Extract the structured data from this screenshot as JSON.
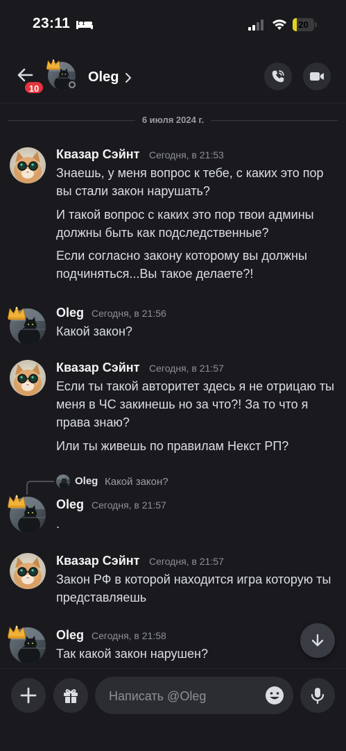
{
  "status_bar": {
    "time": "23:11",
    "battery_level": "20",
    "battery_fraction": 0.2,
    "battery_color": "#e4d11f"
  },
  "header": {
    "back_badge": "10",
    "contact_name": "Oleg",
    "icons": [
      "back-arrow-icon",
      "chevron-right-icon",
      "phone-call-icon",
      "video-camera-icon"
    ]
  },
  "date_divider": "6 июля 2024 г.",
  "messages": [
    {
      "author": "Квазар Сэйнт",
      "time": "Сегодня, в 21:53",
      "lines": [
        "Знаешь, у меня вопрос к тебе, с каких это пор вы стали закон нарушать?",
        "И такой вопрос с каких это пор твои админы должны быть как подследственные?",
        "Если согласно закону которому вы должны подчиняться...Вы такое делаете?!"
      ]
    },
    {
      "author": "Oleg",
      "time": "Сегодня, в 21:56",
      "lines": [
        "Какой закон?"
      ]
    },
    {
      "author": "Квазар Сэйнт",
      "time": "Сегодня, в 21:57",
      "lines": [
        "Если ты такой авторитет  здесь я не отрицаю ты меня в ЧС закинешь но за что?! За то что я права знаю?",
        "Или ты живешь по правилам Некст РП?"
      ]
    },
    {
      "reply": {
        "author": "Oleg",
        "text": "Какой закон?"
      },
      "author": "Oleg",
      "time": "Сегодня, в 21:57",
      "lines": [
        "."
      ]
    },
    {
      "author": "Квазар Сэйнт",
      "time": "Сегодня, в 21:57",
      "lines": [
        "Закон РФ в которой находится игра которую ты представляешь"
      ]
    },
    {
      "author": "Oleg",
      "time": "Сегодня, в 21:58",
      "lines": [
        "Так какой закон нарушен?"
      ]
    }
  ],
  "composer": {
    "placeholder": "Написать @Oleg",
    "icons": [
      "plus-icon",
      "gift-icon",
      "emoji-icon",
      "microphone-icon",
      "arrow-down-icon"
    ]
  },
  "colors": {
    "background": "#1a1a1e",
    "badge": "#e5343d",
    "button": "#2b2d31"
  }
}
